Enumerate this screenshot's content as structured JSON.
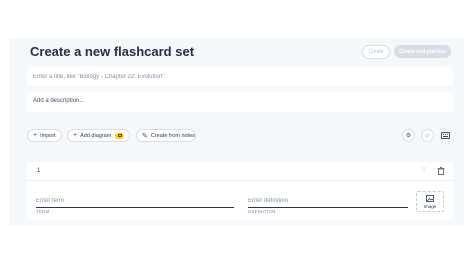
{
  "header": {
    "title": "Create a new flashcard set",
    "create_label": "Create",
    "create_practice_label": "Create and practice"
  },
  "form": {
    "title_placeholder": "Enter a title, like \"Biology - Chapter 22: Evolution\"",
    "description_placeholder": "Add a description..."
  },
  "toolbar": {
    "import_label": "Import",
    "add_diagram_label": "Add diagram",
    "create_from_notes_label": "Create from notes",
    "icons": [
      "plus-icon",
      "plus-icon",
      "notes-icon",
      "settings-icon",
      "swap-icon",
      "keyboard-icon"
    ]
  },
  "card": {
    "number": "1",
    "term_placeholder": "Enter term",
    "definition_placeholder": "Enter definition",
    "term_label": "TERM",
    "definition_label": "DEFINITION",
    "image_label": "Image"
  },
  "colors": {
    "panel_bg": "#f6f7fb",
    "text": "#2e3856",
    "badge": "#ffcd1f",
    "disabled": "#d9dde8"
  }
}
